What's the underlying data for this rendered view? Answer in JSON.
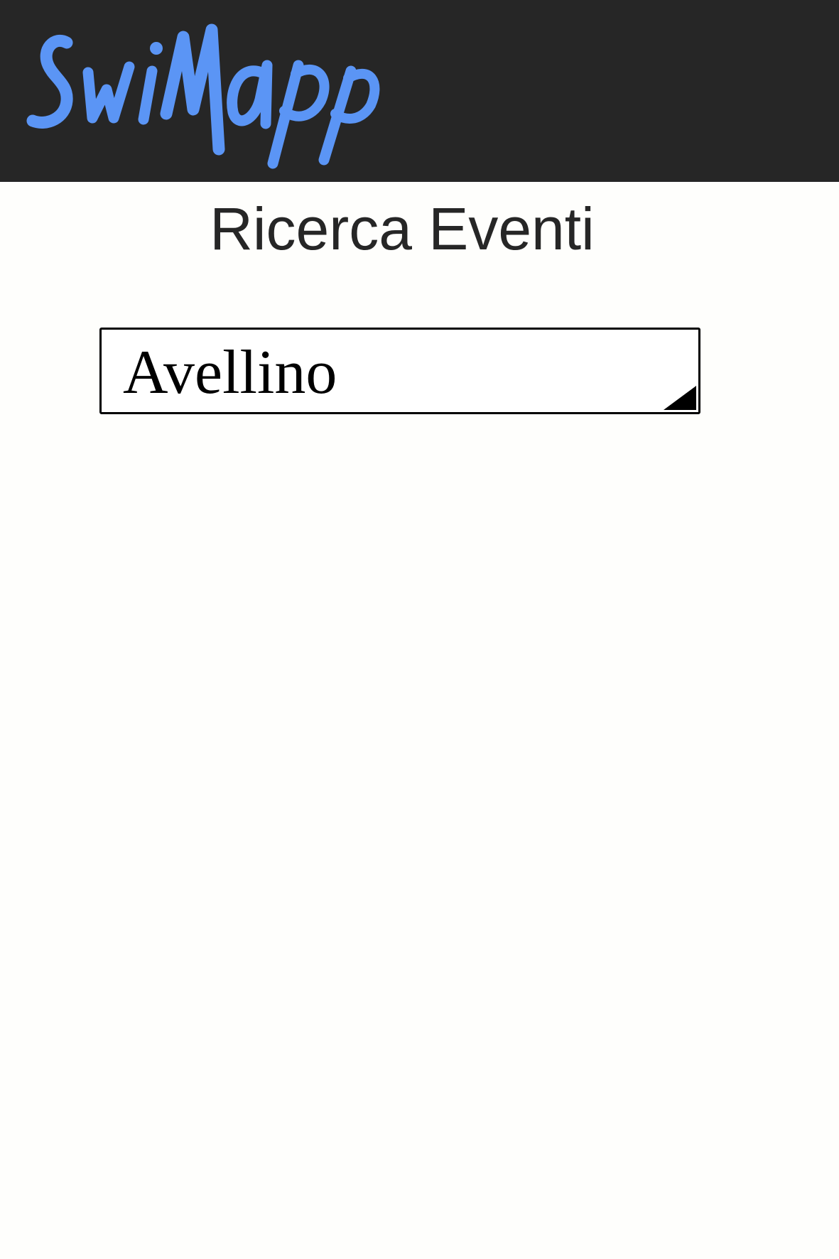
{
  "header": {
    "logo_text": "SwiMapp",
    "logo_color": "#5b95f5",
    "background": "#262626"
  },
  "page": {
    "title": "Ricerca Eventi"
  },
  "city_select": {
    "selected_value": "Avellino",
    "icon": "dropdown-arrow-icon"
  }
}
